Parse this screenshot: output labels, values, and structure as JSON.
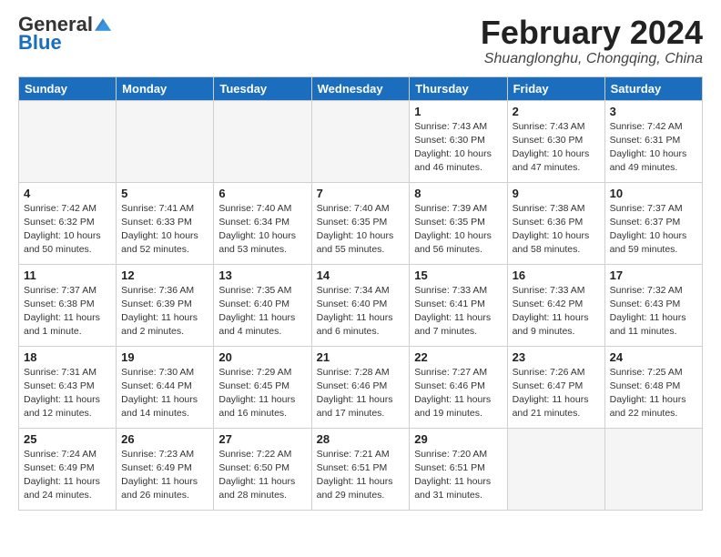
{
  "header": {
    "logo_general": "General",
    "logo_blue": "Blue",
    "month_title": "February 2024",
    "location": "Shuanglonghu, Chongqing, China"
  },
  "days_of_week": [
    "Sunday",
    "Monday",
    "Tuesday",
    "Wednesday",
    "Thursday",
    "Friday",
    "Saturday"
  ],
  "weeks": [
    [
      {
        "day": "",
        "info": ""
      },
      {
        "day": "",
        "info": ""
      },
      {
        "day": "",
        "info": ""
      },
      {
        "day": "",
        "info": ""
      },
      {
        "day": "1",
        "info": "Sunrise: 7:43 AM\nSunset: 6:30 PM\nDaylight: 10 hours\nand 46 minutes."
      },
      {
        "day": "2",
        "info": "Sunrise: 7:43 AM\nSunset: 6:30 PM\nDaylight: 10 hours\nand 47 minutes."
      },
      {
        "day": "3",
        "info": "Sunrise: 7:42 AM\nSunset: 6:31 PM\nDaylight: 10 hours\nand 49 minutes."
      }
    ],
    [
      {
        "day": "4",
        "info": "Sunrise: 7:42 AM\nSunset: 6:32 PM\nDaylight: 10 hours\nand 50 minutes."
      },
      {
        "day": "5",
        "info": "Sunrise: 7:41 AM\nSunset: 6:33 PM\nDaylight: 10 hours\nand 52 minutes."
      },
      {
        "day": "6",
        "info": "Sunrise: 7:40 AM\nSunset: 6:34 PM\nDaylight: 10 hours\nand 53 minutes."
      },
      {
        "day": "7",
        "info": "Sunrise: 7:40 AM\nSunset: 6:35 PM\nDaylight: 10 hours\nand 55 minutes."
      },
      {
        "day": "8",
        "info": "Sunrise: 7:39 AM\nSunset: 6:35 PM\nDaylight: 10 hours\nand 56 minutes."
      },
      {
        "day": "9",
        "info": "Sunrise: 7:38 AM\nSunset: 6:36 PM\nDaylight: 10 hours\nand 58 minutes."
      },
      {
        "day": "10",
        "info": "Sunrise: 7:37 AM\nSunset: 6:37 PM\nDaylight: 10 hours\nand 59 minutes."
      }
    ],
    [
      {
        "day": "11",
        "info": "Sunrise: 7:37 AM\nSunset: 6:38 PM\nDaylight: 11 hours\nand 1 minute."
      },
      {
        "day": "12",
        "info": "Sunrise: 7:36 AM\nSunset: 6:39 PM\nDaylight: 11 hours\nand 2 minutes."
      },
      {
        "day": "13",
        "info": "Sunrise: 7:35 AM\nSunset: 6:40 PM\nDaylight: 11 hours\nand 4 minutes."
      },
      {
        "day": "14",
        "info": "Sunrise: 7:34 AM\nSunset: 6:40 PM\nDaylight: 11 hours\nand 6 minutes."
      },
      {
        "day": "15",
        "info": "Sunrise: 7:33 AM\nSunset: 6:41 PM\nDaylight: 11 hours\nand 7 minutes."
      },
      {
        "day": "16",
        "info": "Sunrise: 7:33 AM\nSunset: 6:42 PM\nDaylight: 11 hours\nand 9 minutes."
      },
      {
        "day": "17",
        "info": "Sunrise: 7:32 AM\nSunset: 6:43 PM\nDaylight: 11 hours\nand 11 minutes."
      }
    ],
    [
      {
        "day": "18",
        "info": "Sunrise: 7:31 AM\nSunset: 6:43 PM\nDaylight: 11 hours\nand 12 minutes."
      },
      {
        "day": "19",
        "info": "Sunrise: 7:30 AM\nSunset: 6:44 PM\nDaylight: 11 hours\nand 14 minutes."
      },
      {
        "day": "20",
        "info": "Sunrise: 7:29 AM\nSunset: 6:45 PM\nDaylight: 11 hours\nand 16 minutes."
      },
      {
        "day": "21",
        "info": "Sunrise: 7:28 AM\nSunset: 6:46 PM\nDaylight: 11 hours\nand 17 minutes."
      },
      {
        "day": "22",
        "info": "Sunrise: 7:27 AM\nSunset: 6:46 PM\nDaylight: 11 hours\nand 19 minutes."
      },
      {
        "day": "23",
        "info": "Sunrise: 7:26 AM\nSunset: 6:47 PM\nDaylight: 11 hours\nand 21 minutes."
      },
      {
        "day": "24",
        "info": "Sunrise: 7:25 AM\nSunset: 6:48 PM\nDaylight: 11 hours\nand 22 minutes."
      }
    ],
    [
      {
        "day": "25",
        "info": "Sunrise: 7:24 AM\nSunset: 6:49 PM\nDaylight: 11 hours\nand 24 minutes."
      },
      {
        "day": "26",
        "info": "Sunrise: 7:23 AM\nSunset: 6:49 PM\nDaylight: 11 hours\nand 26 minutes."
      },
      {
        "day": "27",
        "info": "Sunrise: 7:22 AM\nSunset: 6:50 PM\nDaylight: 11 hours\nand 28 minutes."
      },
      {
        "day": "28",
        "info": "Sunrise: 7:21 AM\nSunset: 6:51 PM\nDaylight: 11 hours\nand 29 minutes."
      },
      {
        "day": "29",
        "info": "Sunrise: 7:20 AM\nSunset: 6:51 PM\nDaylight: 11 hours\nand 31 minutes."
      },
      {
        "day": "",
        "info": ""
      },
      {
        "day": "",
        "info": ""
      }
    ]
  ]
}
